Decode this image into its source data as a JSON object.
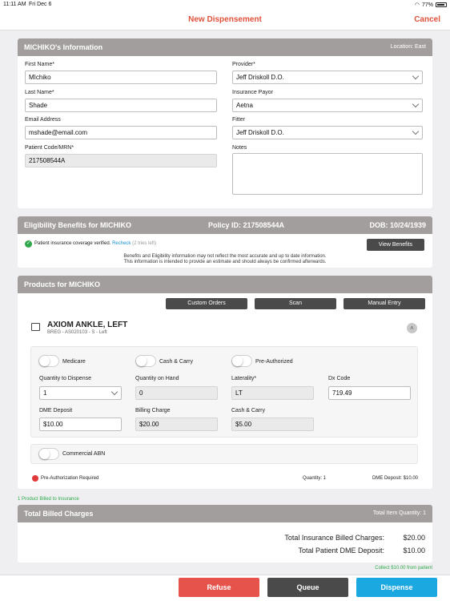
{
  "status": {
    "time": "11:11 AM",
    "date": "Fri Dec 6",
    "battery": "77%"
  },
  "nav": {
    "title": "New Dispensement",
    "cancel": "Cancel"
  },
  "patient_card": {
    "title": "MICHIKO's Information",
    "location": "Location: East",
    "first_name_label": "First Name*",
    "first_name": "MIchiko",
    "last_name_label": "Last Name*",
    "last_name": "Shade",
    "email_label": "Email Address",
    "email": "mshade@email.com",
    "mrn_label": "Patient Code/MRN*",
    "mrn": "217508544A",
    "provider_label": "Provider*",
    "provider": "Jeff Driskoll D.O.",
    "payor_label": "Insurance Payor",
    "payor": "Aetna",
    "fitter_label": "Fitter",
    "fitter": "Jeff Driskoll D.O.",
    "notes_label": "Notes"
  },
  "eligibility": {
    "title": "Eligibility Benefits for MICHIKO",
    "policy": "Policy ID: 217508544A",
    "dob": "DOB: 10/24/1939",
    "verified": "Patient insurance coverage verified.",
    "recheck": "Recheck",
    "tries": "(2 tries left)",
    "view_button": "View Benefits",
    "disclaimer1": "Benefits and Eligibility information may not reflect the most accurate and up to date information.",
    "disclaimer2": "This information is intended to provide an estimate and should always be confirmed afterwards."
  },
  "products": {
    "title": "Products for MICHIKO",
    "custom_orders": "Custom Orders",
    "scan": "Scan",
    "manual_entry": "Manual Entry",
    "item_name": "AXIOM ANKLE, LEFT",
    "item_sub": "BREG - AS020103 - S - Left",
    "medicare": "Medicare",
    "cash_carry_toggle": "Cash & Carry",
    "pre_authorized": "Pre-Authorized",
    "qty_dispense_label": "Quantity to Dispense",
    "qty_dispense": "1",
    "qty_hand_label": "Quantity on Hand",
    "qty_hand": "0",
    "laterality_label": "Laterality*",
    "laterality": "LT",
    "dx_label": "Dx Code",
    "dx": "719.49",
    "dme_label": "DME Deposit",
    "dme": "$10.00",
    "billing_label": "Billing Charge",
    "billing": "$20.00",
    "cash_label": "Cash & Carry",
    "cash": "$5.00",
    "commercial_abn": "Commercial ABN",
    "preauth_required": "Pre-Authorization Required",
    "footer_qty": "Quantity: 1",
    "footer_dme": "DME Deposit: $10.00",
    "billed_note": "1 Product Billed to Insurance",
    "colors": {
      "alert": "#e03a3a",
      "ok": "#2ea84a"
    }
  },
  "totals": {
    "title": "Total Billed Charges",
    "item_qty": "Total Item Quantity: 1",
    "ins_label": "Total Insurance Billed Charges:",
    "ins_value": "$20.00",
    "dme_label": "Total Patient DME Deposit:",
    "dme_value": "$10.00",
    "collect": "Collect $10.00 from patient"
  },
  "actions": {
    "refuse": "Refuse",
    "queue": "Queue",
    "dispense": "Dispense",
    "colors": {
      "refuse": "#e5534b",
      "queue": "#4a4a4a",
      "dispense": "#1ba7e0"
    }
  }
}
